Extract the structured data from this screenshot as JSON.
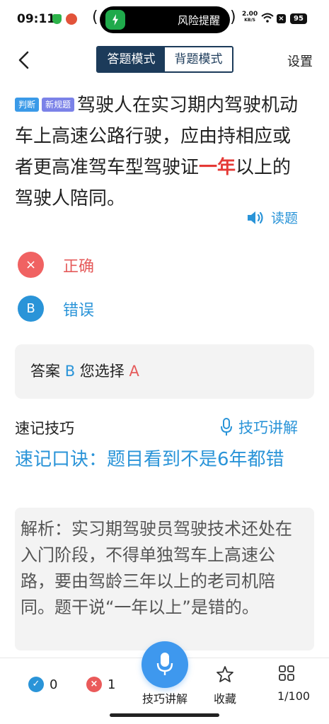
{
  "status_bar": {
    "time": "09:11",
    "island_text": "风险提醒",
    "speed_value": "2.00",
    "speed_unit": "KB/S",
    "battery": "95"
  },
  "header": {
    "mode_tabs": [
      {
        "label": "答题模式",
        "active": true
      },
      {
        "label": "背题模式",
        "active": false
      }
    ],
    "settings_label": "设置"
  },
  "question": {
    "tag_type": "判断",
    "tag_new": "新规题",
    "text_before": "驾驶人在实习期内驾驶机动车上高速公路行驶，应由持相应或者更高准驾车型驾驶证",
    "text_highlight": "一年",
    "text_after": "以上的驾驶人陪同。",
    "read_label": "读题"
  },
  "options": [
    {
      "marker": "×",
      "label": "正确",
      "state": "wrong-selected"
    },
    {
      "marker": "B",
      "label": "错误",
      "state": "correct"
    }
  ],
  "answer": {
    "answer_label": "答案",
    "answer_value": "B",
    "choice_label": "您选择",
    "choice_value": "A"
  },
  "tips": {
    "title": "速记技巧",
    "link_label": "技巧讲解",
    "mnemonic": "速记口诀：题目看到不是6年都错",
    "analysis": "解析：实习期驾驶员驾驶技术还处在入门阶段，不得单独驾车上高速公路，要由驾龄三年以上的老司机陪同。题干说“一年以上”是错的。"
  },
  "bottom_bar": {
    "correct_count": "0",
    "wrong_count": "1",
    "mic_label": "技巧讲解",
    "favorite_label": "收藏",
    "progress": "1/100"
  },
  "colors": {
    "accent_blue": "#2a94d8",
    "error_red": "#e55b5b",
    "header_navy": "#1c3b5a",
    "fab_blue": "#3e98ee"
  },
  "icons": [
    "back-arrow-icon",
    "speaker-icon",
    "close-icon",
    "microphone-icon",
    "check-icon",
    "star-icon",
    "grid-icon"
  ]
}
